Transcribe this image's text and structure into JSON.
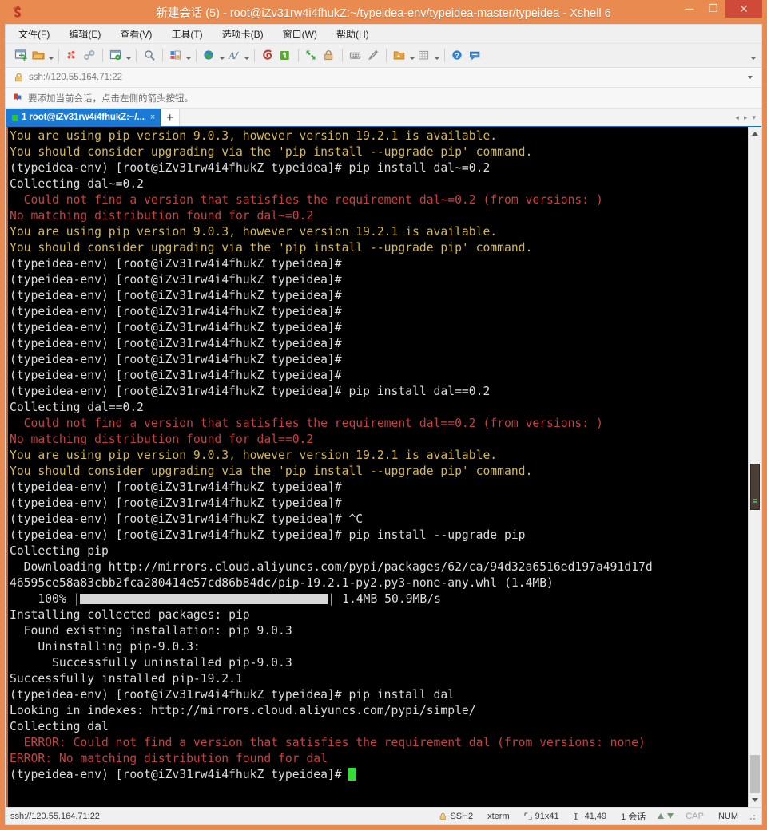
{
  "window": {
    "title": "新建会话 (5) - root@iZv31rw4i4fhukZ:~/typeidea-env/typeidea-master/typeidea - Xshell 6",
    "logo_icon": "xshell-logo-icon",
    "minimize_label": "─",
    "maximize_label": "❐",
    "close_label": "✕"
  },
  "menubar": {
    "items": [
      {
        "label": "文件(F)",
        "name": "menu-file"
      },
      {
        "label": "编辑(E)",
        "name": "menu-edit"
      },
      {
        "label": "查看(V)",
        "name": "menu-view"
      },
      {
        "label": "工具(T)",
        "name": "menu-tools"
      },
      {
        "label": "选项卡(B)",
        "name": "menu-tabs"
      },
      {
        "label": "窗口(W)",
        "name": "menu-window"
      },
      {
        "label": "帮助(H)",
        "name": "menu-help"
      }
    ]
  },
  "toolbar": {
    "icons": [
      "new-session-icon",
      "open-folder-icon",
      "disconnect-icon",
      "reconnect-icon",
      "session-properties-icon",
      "find-icon",
      "layout-icon",
      "transfer-icon",
      "font-icon",
      "log-icon",
      "capture-icon",
      "fullscreen-icon",
      "lock-icon",
      "keyboard-icon",
      "highlight-icon",
      "folder-send-icon",
      "grid-icon",
      "help-icon",
      "chat-icon"
    ],
    "overflow_label": "▾"
  },
  "address": {
    "lock_icon": "lock-icon",
    "value": "ssh://120.55.164.71:22",
    "dropdown_icon": "chevron-down-icon"
  },
  "notice": {
    "icon": "bookmark-icon",
    "text": "要添加当前会话，点击左侧的箭头按钮。"
  },
  "tabs": {
    "items": [
      {
        "label": "1 root@iZv31rw4i4fhukZ:~/...",
        "close_label": "×",
        "status": "connected"
      }
    ],
    "new_tab_label": "+",
    "nav_prev": "◂",
    "nav_next": "▸",
    "nav_menu": "▾"
  },
  "terminal": {
    "cursor_color": "#33dd33",
    "progress_percent": 100,
    "lines": [
      [
        {
          "t": "You are using pip version 9.0.3, however version 19.2.1 is available.",
          "c": "yellow"
        }
      ],
      [
        {
          "t": "You should consider upgrading via the 'pip install --upgrade pip' command.",
          "c": "yellow"
        }
      ],
      [
        {
          "t": "(typeidea-env) [root@iZv31rw4i4fhukZ typeidea]# pip install dal~=0.2",
          "c": "white"
        }
      ],
      [
        {
          "t": "Collecting dal~=0.2",
          "c": "white"
        }
      ],
      [
        {
          "t": "  Could not find a version that satisfies the requirement dal~=0.2 (from versions: )",
          "c": "red"
        }
      ],
      [
        {
          "t": "No matching distribution found for dal~=0.2",
          "c": "red"
        }
      ],
      [
        {
          "t": "You are using pip version 9.0.3, however version 19.2.1 is available.",
          "c": "yellow"
        }
      ],
      [
        {
          "t": "You should consider upgrading via the 'pip install --upgrade pip' command.",
          "c": "yellow"
        }
      ],
      [
        {
          "t": "(typeidea-env) [root@iZv31rw4i4fhukZ typeidea]#",
          "c": "white"
        }
      ],
      [
        {
          "t": "(typeidea-env) [root@iZv31rw4i4fhukZ typeidea]#",
          "c": "white"
        }
      ],
      [
        {
          "t": "(typeidea-env) [root@iZv31rw4i4fhukZ typeidea]#",
          "c": "white"
        }
      ],
      [
        {
          "t": "(typeidea-env) [root@iZv31rw4i4fhukZ typeidea]#",
          "c": "white"
        }
      ],
      [
        {
          "t": "(typeidea-env) [root@iZv31rw4i4fhukZ typeidea]#",
          "c": "white"
        }
      ],
      [
        {
          "t": "(typeidea-env) [root@iZv31rw4i4fhukZ typeidea]#",
          "c": "white"
        }
      ],
      [
        {
          "t": "(typeidea-env) [root@iZv31rw4i4fhukZ typeidea]#",
          "c": "white"
        }
      ],
      [
        {
          "t": "(typeidea-env) [root@iZv31rw4i4fhukZ typeidea]#",
          "c": "white"
        }
      ],
      [
        {
          "t": "(typeidea-env) [root@iZv31rw4i4fhukZ typeidea]# pip install dal==0.2",
          "c": "white"
        }
      ],
      [
        {
          "t": "Collecting dal==0.2",
          "c": "white"
        }
      ],
      [
        {
          "t": "  Could not find a version that satisfies the requirement dal==0.2 (from versions: )",
          "c": "red"
        }
      ],
      [
        {
          "t": "No matching distribution found for dal==0.2",
          "c": "red"
        }
      ],
      [
        {
          "t": "You are using pip version 9.0.3, however version 19.2.1 is available.",
          "c": "yellow"
        }
      ],
      [
        {
          "t": "You should consider upgrading via the 'pip install --upgrade pip' command.",
          "c": "yellow"
        }
      ],
      [
        {
          "t": "(typeidea-env) [root@iZv31rw4i4fhukZ typeidea]#",
          "c": "white"
        }
      ],
      [
        {
          "t": "(typeidea-env) [root@iZv31rw4i4fhukZ typeidea]#",
          "c": "white"
        }
      ],
      [
        {
          "t": "(typeidea-env) [root@iZv31rw4i4fhukZ typeidea]# ^C",
          "c": "white"
        }
      ],
      [
        {
          "t": "(typeidea-env) [root@iZv31rw4i4fhukZ typeidea]# pip install --upgrade pip",
          "c": "white"
        }
      ],
      [
        {
          "t": "Collecting pip",
          "c": "white"
        }
      ],
      [
        {
          "t": "  Downloading http://mirrors.cloud.aliyuncs.com/pypi/packages/62/ca/94d32a6516ed197a491d17d",
          "c": "white"
        }
      ],
      [
        {
          "t": "46595ce58a83cbb2fca280414e57cd86b84dc/pip-19.2.1-py2.py3-none-any.whl (1.4MB)",
          "c": "white"
        }
      ],
      [
        {
          "t": "    100% |",
          "c": "white"
        },
        {
          "bar": true
        },
        {
          "t": "| 1.4MB 50.9MB/s",
          "c": "white"
        }
      ],
      [
        {
          "t": "Installing collected packages: pip",
          "c": "white"
        }
      ],
      [
        {
          "t": "  Found existing installation: pip 9.0.3",
          "c": "white"
        }
      ],
      [
        {
          "t": "    Uninstalling pip-9.0.3:",
          "c": "white"
        }
      ],
      [
        {
          "t": "      Successfully uninstalled pip-9.0.3",
          "c": "white"
        }
      ],
      [
        {
          "t": "Successfully installed pip-19.2.1",
          "c": "white"
        }
      ],
      [
        {
          "t": "(typeidea-env) [root@iZv31rw4i4fhukZ typeidea]# pip install dal",
          "c": "white"
        }
      ],
      [
        {
          "t": "Looking in indexes: http://mirrors.cloud.aliyuncs.com/pypi/simple/",
          "c": "white"
        }
      ],
      [
        {
          "t": "Collecting dal",
          "c": "white"
        }
      ],
      [
        {
          "t": "  ERROR: Could not find a version that satisfies the requirement dal (from versions: none)",
          "c": "red"
        }
      ],
      [
        {
          "t": "ERROR: No matching distribution found for dal",
          "c": "red"
        }
      ],
      [
        {
          "t": "(typeidea-env) [root@iZv31rw4i4fhukZ typeidea]# ",
          "c": "white"
        },
        {
          "cursor": true
        }
      ]
    ]
  },
  "statusbar": {
    "connection": "ssh://120.55.164.71:22",
    "protocol_icon": "lock-icon",
    "protocol": "SSH2",
    "terminal_type": "xterm",
    "size_icon": "size-icon",
    "size": "91x41",
    "cursor_icon": "cursor-pos-icon",
    "cursor_pos": "41,49",
    "sessions": "1 会话",
    "caps": "CAP",
    "num": "NUM"
  }
}
